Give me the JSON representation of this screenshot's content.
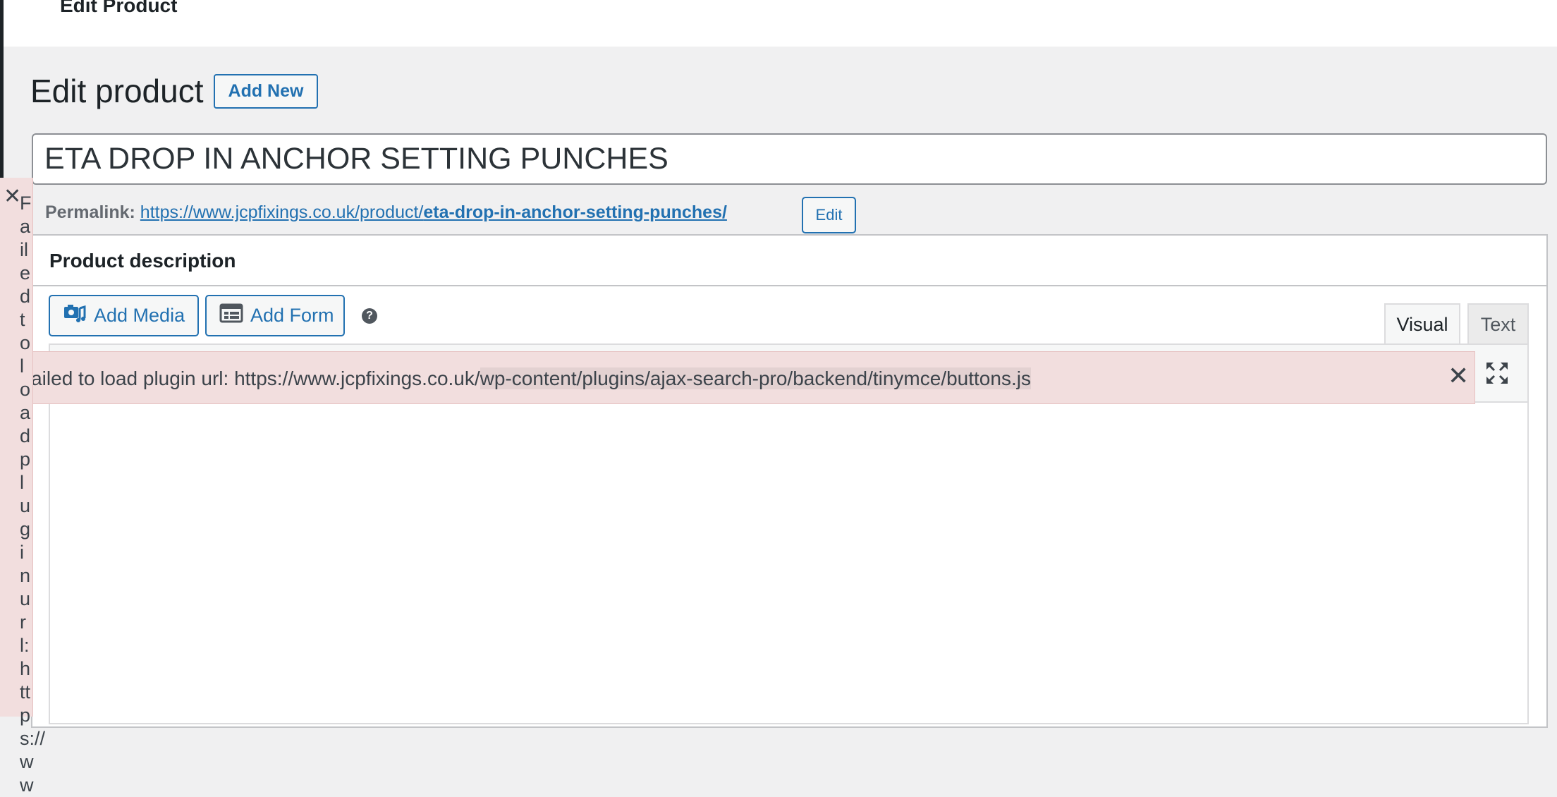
{
  "top_bar": {
    "title": "Edit Product"
  },
  "page": {
    "heading": "Edit product",
    "add_new_label": "Add New"
  },
  "product": {
    "title": "ETA DROP IN ANCHOR SETTING PUNCHES"
  },
  "permalink": {
    "label": "Permalink:",
    "base_url": "https://www.jcpfixings.co.uk/product/",
    "slug": "eta-drop-in-anchor-setting-punches/",
    "edit_label": "Edit"
  },
  "description_box": {
    "title": "Product description",
    "add_media_label": "Add Media",
    "add_form_label": "Add Form",
    "help_icon": "question-icon",
    "tabs": {
      "visual": "Visual",
      "text": "Text"
    },
    "fullscreen_icon": "fullscreen-icon"
  },
  "notice": {
    "text_prefix": "Failed to load plugin url: https://www.jcpfixings.co.uk/",
    "text_highlight": "wp-content/plugins/ajax-search-pro/backend/tinymce/buttons.js",
    "close_icon": "close-icon"
  },
  "side_notice": {
    "text": "Failed to load plugin url: https://ww",
    "close_icon": "close-icon"
  },
  "colors": {
    "accent": "#2271b1",
    "notice_bg": "#f2dede",
    "page_bg": "#f0f0f1"
  }
}
